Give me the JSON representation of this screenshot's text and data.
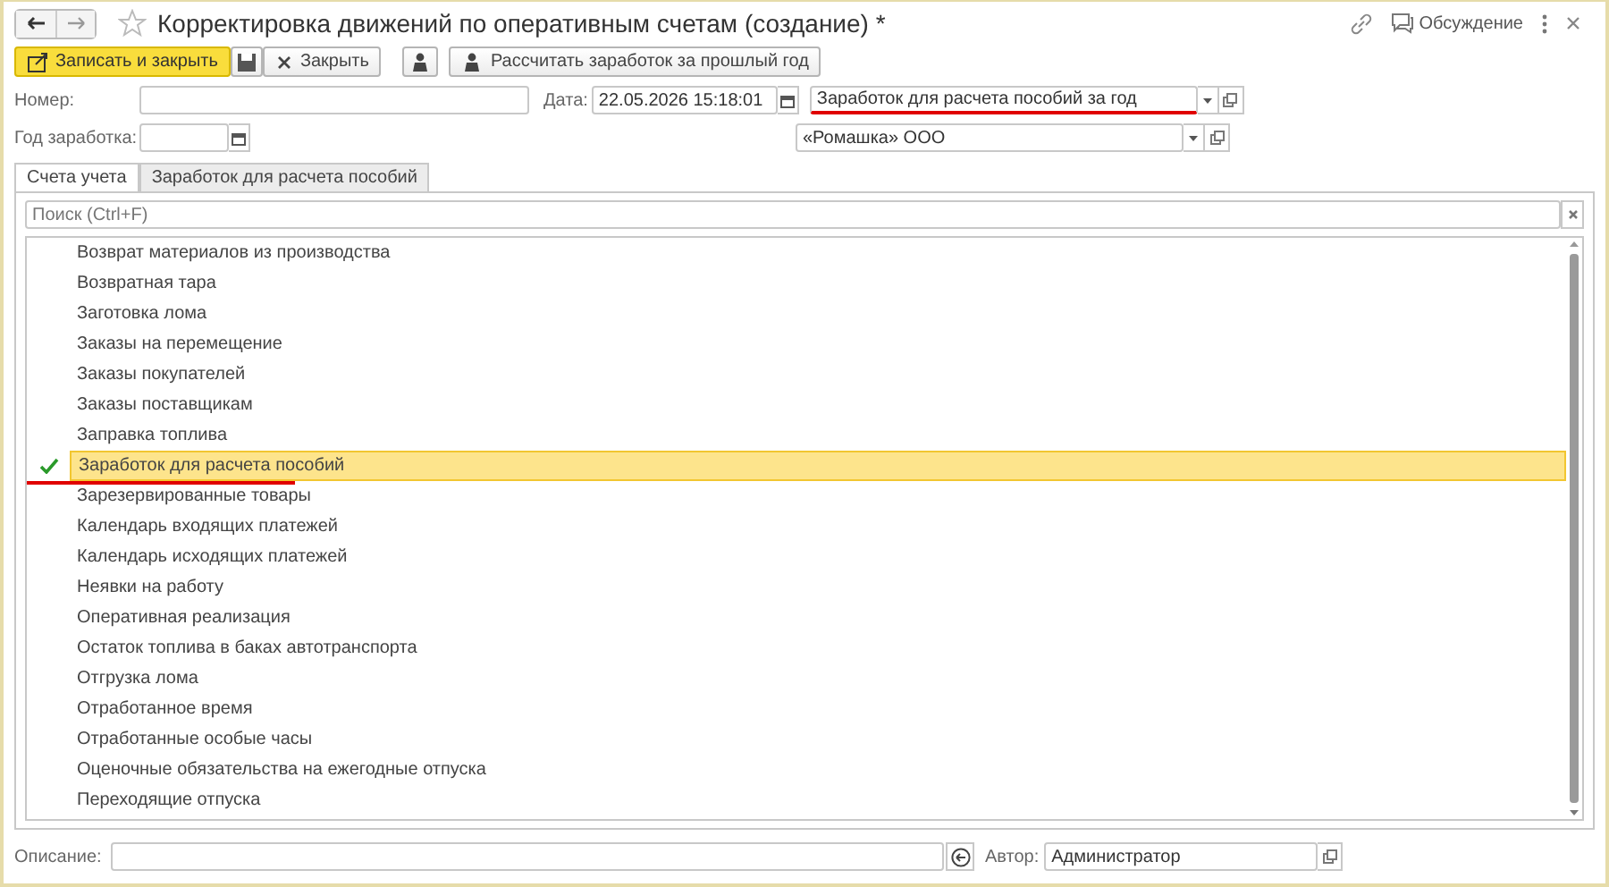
{
  "window": {
    "title": "Корректировка движений по оперативным счетам (создание) *",
    "discussion": "Обсуждение"
  },
  "toolbar": {
    "buttons": [
      {
        "label": "Записать и закрыть",
        "kind": "primary"
      },
      {
        "kind": "save"
      },
      {
        "label": "Закрыть",
        "kind": "close"
      },
      {
        "kind": "person"
      },
      {
        "label": "Рассчитать заработок за прошлый год",
        "kind": "person-text"
      }
    ]
  },
  "fields": {
    "number": {
      "label": "Номер:"
    },
    "date": {
      "label": "Дата:",
      "value": "22.05.2026 15:18:01"
    },
    "operation": {
      "value": "Заработок для расчета пособий за год",
      "underlined": true
    },
    "year": {
      "label": "Год заработка:"
    },
    "organization": {
      "value": "«Ромашка» ООО",
      "underlined": false
    }
  },
  "tabs": [
    {
      "label": "Счета учета",
      "selected": true
    },
    {
      "label": "Заработок для расчета пособий",
      "selected": false
    }
  ],
  "search": {
    "placeholder": "Поиск (Ctrl+F)"
  },
  "accounts": [
    {
      "name": "Возврат материалов из производства",
      "selected": false,
      "underlined": false
    },
    {
      "name": "Возвратная тара",
      "selected": false,
      "underlined": false
    },
    {
      "name": "Заготовка лома",
      "selected": false,
      "underlined": false
    },
    {
      "name": "Заказы на перемещение",
      "selected": false,
      "underlined": false
    },
    {
      "name": "Заказы покупателей",
      "selected": false,
      "underlined": false
    },
    {
      "name": "Заказы поставщикам",
      "selected": false,
      "underlined": false
    },
    {
      "name": "Заправка топлива",
      "selected": false,
      "underlined": false
    },
    {
      "name": "Заработок для расчета пособий",
      "selected": true,
      "underlined": true
    },
    {
      "name": "Зарезервированные товары",
      "selected": false,
      "underlined": false
    },
    {
      "name": "Календарь входящих платежей",
      "selected": false,
      "underlined": false
    },
    {
      "name": "Календарь исходящих платежей",
      "selected": false,
      "underlined": false
    },
    {
      "name": "Неявки на работу",
      "selected": false,
      "underlined": false
    },
    {
      "name": "Оперативная реализация",
      "selected": false,
      "underlined": false
    },
    {
      "name": "Остаток топлива в баках автотранспорта",
      "selected": false,
      "underlined": false
    },
    {
      "name": "Отгрузка лома",
      "selected": false,
      "underlined": false
    },
    {
      "name": "Отработанное время",
      "selected": false,
      "underlined": false
    },
    {
      "name": "Отработанные особые часы",
      "selected": false,
      "underlined": false
    },
    {
      "name": "Оценочные обязательства на ежегодные отпуска",
      "selected": false,
      "underlined": false
    },
    {
      "name": "Переходящие отпуска",
      "selected": false,
      "underlined": false
    }
  ],
  "footer": {
    "description": {
      "label": "Описание:"
    },
    "author": {
      "label": "Автор:",
      "value": "Администратор"
    }
  }
}
